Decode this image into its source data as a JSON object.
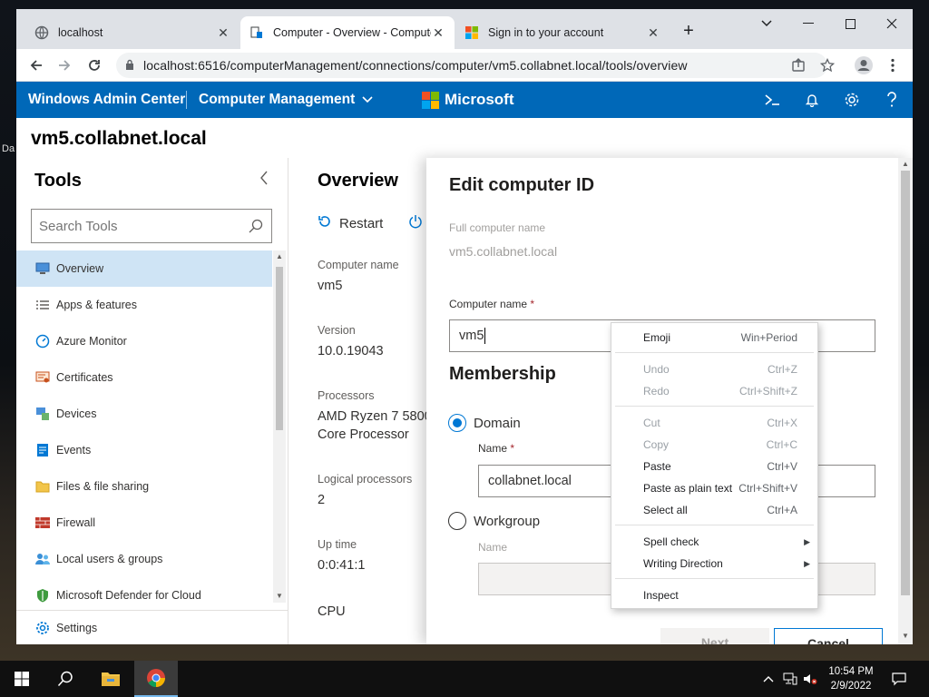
{
  "desktop": {
    "partial_label": "Da"
  },
  "browser": {
    "tabs": [
      {
        "title": "localhost",
        "icon": "globe-icon"
      },
      {
        "title": "Computer - Overview - Compute",
        "icon": "server-icon"
      },
      {
        "title": "Sign in to your account",
        "icon": "microsoft-icon"
      }
    ],
    "close_glyph": "✕",
    "new_tab_glyph": "+",
    "url": "localhost:6516/computerManagement/connections/computer/vm5.collabnet.local/tools/overview"
  },
  "header": {
    "app_title": "Windows Admin Center",
    "context": "Computer Management",
    "brand": "Microsoft",
    "colors": {
      "bar": "#0068b8",
      "ms_red": "#f25022",
      "ms_green": "#7fba00",
      "ms_blue": "#00a4ef",
      "ms_yellow": "#ffb900"
    }
  },
  "server": {
    "name": "vm5.collabnet.local"
  },
  "tools": {
    "title": "Tools",
    "search_placeholder": "Search Tools",
    "items": [
      {
        "label": "Overview",
        "icon": "overview-icon"
      },
      {
        "label": "Apps & features",
        "icon": "list-icon"
      },
      {
        "label": "Azure Monitor",
        "icon": "monitor-icon"
      },
      {
        "label": "Certificates",
        "icon": "certificate-icon"
      },
      {
        "label": "Devices",
        "icon": "devices-icon"
      },
      {
        "label": "Events",
        "icon": "events-icon"
      },
      {
        "label": "Files & file sharing",
        "icon": "folder-icon"
      },
      {
        "label": "Firewall",
        "icon": "firewall-icon"
      },
      {
        "label": "Local users & groups",
        "icon": "users-icon"
      },
      {
        "label": "Microsoft Defender for Cloud",
        "icon": "shield-icon"
      }
    ],
    "settings_label": "Settings"
  },
  "overview": {
    "title": "Overview",
    "restart_label": "Restart",
    "fields": [
      {
        "label": "Computer name",
        "value": "vm5"
      },
      {
        "label": "Version",
        "value": "10.0.19043"
      },
      {
        "label": "Processors",
        "value_line1": "AMD Ryzen 7 5800",
        "value_line2": "Core Processor"
      },
      {
        "label": "Logical processors",
        "value": "2"
      },
      {
        "label": "Up time",
        "value": "0:0:41:1"
      }
    ],
    "cpu_label": "CPU"
  },
  "edit_panel": {
    "title": "Edit computer ID",
    "full_name_label": "Full computer name",
    "full_name_value": "vm5.collabnet.local",
    "computer_name_label": "Computer name",
    "required_mark": "*",
    "computer_name_value": "vm5",
    "membership_heading": "Membership",
    "domain_label": "Domain",
    "domain_name_label": "Name",
    "domain_name_value": "collabnet.local",
    "workgroup_label": "Workgroup",
    "workgroup_name_label": "Name",
    "next_label": "Next",
    "cancel_label": "Cancel"
  },
  "context_menu": {
    "items": [
      {
        "label": "Emoji",
        "shortcut": "Win+Period"
      },
      {
        "label": "Undo",
        "shortcut": "Ctrl+Z",
        "disabled": true
      },
      {
        "label": "Redo",
        "shortcut": "Ctrl+Shift+Z",
        "disabled": true
      },
      {
        "label": "Cut",
        "shortcut": "Ctrl+X",
        "disabled": true
      },
      {
        "label": "Copy",
        "shortcut": "Ctrl+C",
        "disabled": true
      },
      {
        "label": "Paste",
        "shortcut": "Ctrl+V"
      },
      {
        "label": "Paste as plain text",
        "shortcut": "Ctrl+Shift+V"
      },
      {
        "label": "Select all",
        "shortcut": "Ctrl+A"
      },
      {
        "label": "Spell check",
        "shortcut": ""
      },
      {
        "label": "Writing Direction",
        "shortcut": ""
      },
      {
        "label": "Inspect",
        "shortcut": ""
      }
    ]
  },
  "taskbar": {
    "time": "10:54 PM",
    "date": "2/9/2022"
  }
}
